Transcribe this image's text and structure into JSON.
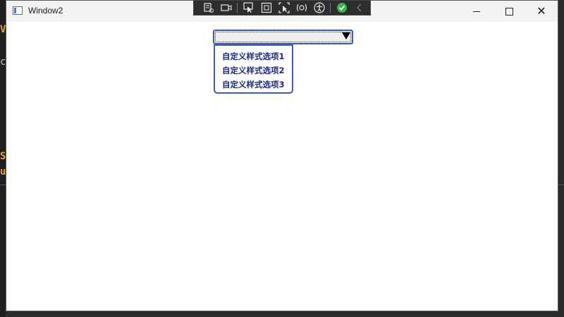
{
  "window": {
    "title": "Window2"
  },
  "background_fragments": [
    {
      "text": "V",
      "color": "#e8a03c"
    },
    {
      "text": "ca",
      "color": "#c8c8c8"
    },
    {
      "text": "S",
      "color": "#e8a03c"
    },
    {
      "text": "u",
      "color": "#e8a03c"
    }
  ],
  "toolbar": {
    "icons": [
      "live-visual-tree-icon",
      "record-icon",
      "select-element-icon",
      "display-layout-adorners-icon",
      "track-focus-icon",
      "binding-failures-icon",
      "accessibility-icon",
      "checked-icon",
      "collapse-icon"
    ]
  },
  "combo": {
    "selected_value": "",
    "options": [
      "自定义样式选项1",
      "自定义样式选项2",
      "自定义样式选项3"
    ]
  },
  "colors": {
    "accent_border": "#3e5bb8",
    "item_text": "#1c2a7c"
  }
}
